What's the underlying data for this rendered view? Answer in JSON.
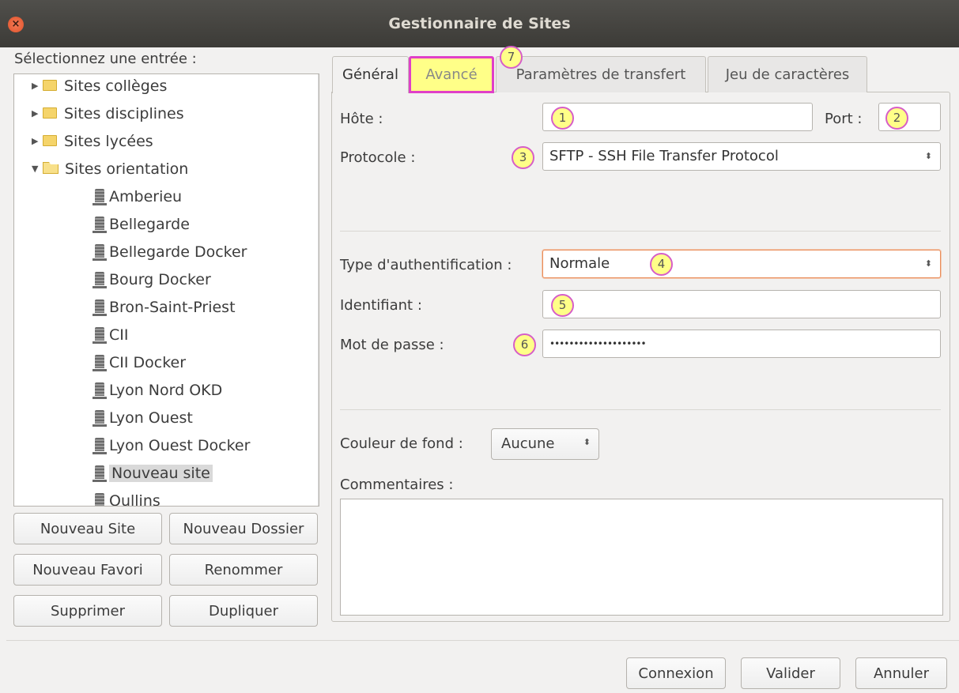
{
  "window": {
    "title": "Gestionnaire de Sites",
    "close_glyph": "×"
  },
  "sidebar": {
    "label": "Sélectionnez une entrée :",
    "tree": [
      {
        "label": "Sites collèges",
        "type": "folder",
        "expanded": false
      },
      {
        "label": "Sites disciplines",
        "type": "folder",
        "expanded": false
      },
      {
        "label": "Sites lycées",
        "type": "folder",
        "expanded": false
      },
      {
        "label": "Sites orientation",
        "type": "folder",
        "expanded": true
      },
      {
        "label": "Amberieu",
        "type": "server"
      },
      {
        "label": "Bellegarde",
        "type": "server"
      },
      {
        "label": "Bellegarde Docker",
        "type": "server"
      },
      {
        "label": "Bourg Docker",
        "type": "server"
      },
      {
        "label": "Bron-Saint-Priest",
        "type": "server"
      },
      {
        "label": "CII",
        "type": "server"
      },
      {
        "label": "CII Docker",
        "type": "server"
      },
      {
        "label": "Lyon Nord OKD",
        "type": "server"
      },
      {
        "label": "Lyon Ouest",
        "type": "server"
      },
      {
        "label": "Lyon Ouest Docker",
        "type": "server"
      },
      {
        "label": "Nouveau site",
        "type": "server",
        "selected": true
      },
      {
        "label": "Oullins",
        "type": "server"
      }
    ],
    "buttons": {
      "new_site": "Nouveau Site",
      "new_folder": "Nouveau Dossier",
      "new_bookmark": "Nouveau Favori",
      "rename": "Renommer",
      "delete": "Supprimer",
      "duplicate": "Dupliquer"
    }
  },
  "tabs": [
    {
      "label": "Général",
      "active": true
    },
    {
      "label": "Avancé",
      "highlighted": true
    },
    {
      "label": "Paramètres de transfert"
    },
    {
      "label": "Jeu de caractères"
    }
  ],
  "general": {
    "host_label": "Hôte :",
    "host_value": "",
    "port_label": "Port :",
    "port_value": "",
    "protocol_label": "Protocole :",
    "protocol_value": "SFTP - SSH File Transfer Protocol",
    "auth_type_label": "Type d'authentification :",
    "auth_type_value": "Normale",
    "user_label": "Identifiant :",
    "user_value": "",
    "password_label": "Mot de passe :",
    "password_value": "••••••••••••••••••••",
    "bg_color_label": "Couleur de fond :",
    "bg_color_value": "Aucune",
    "comments_label": "Commentaires :",
    "comments_value": ""
  },
  "markers": {
    "m1": "1",
    "m2": "2",
    "m3": "3",
    "m4": "4",
    "m5": "5",
    "m6": "6",
    "m7": "7"
  },
  "footer": {
    "connect": "Connexion",
    "validate": "Valider",
    "cancel": "Annuler"
  },
  "colors": {
    "highlight_fill": "#ffff88",
    "highlight_border": "#e040c8",
    "focus_border": "#e98c5a"
  }
}
